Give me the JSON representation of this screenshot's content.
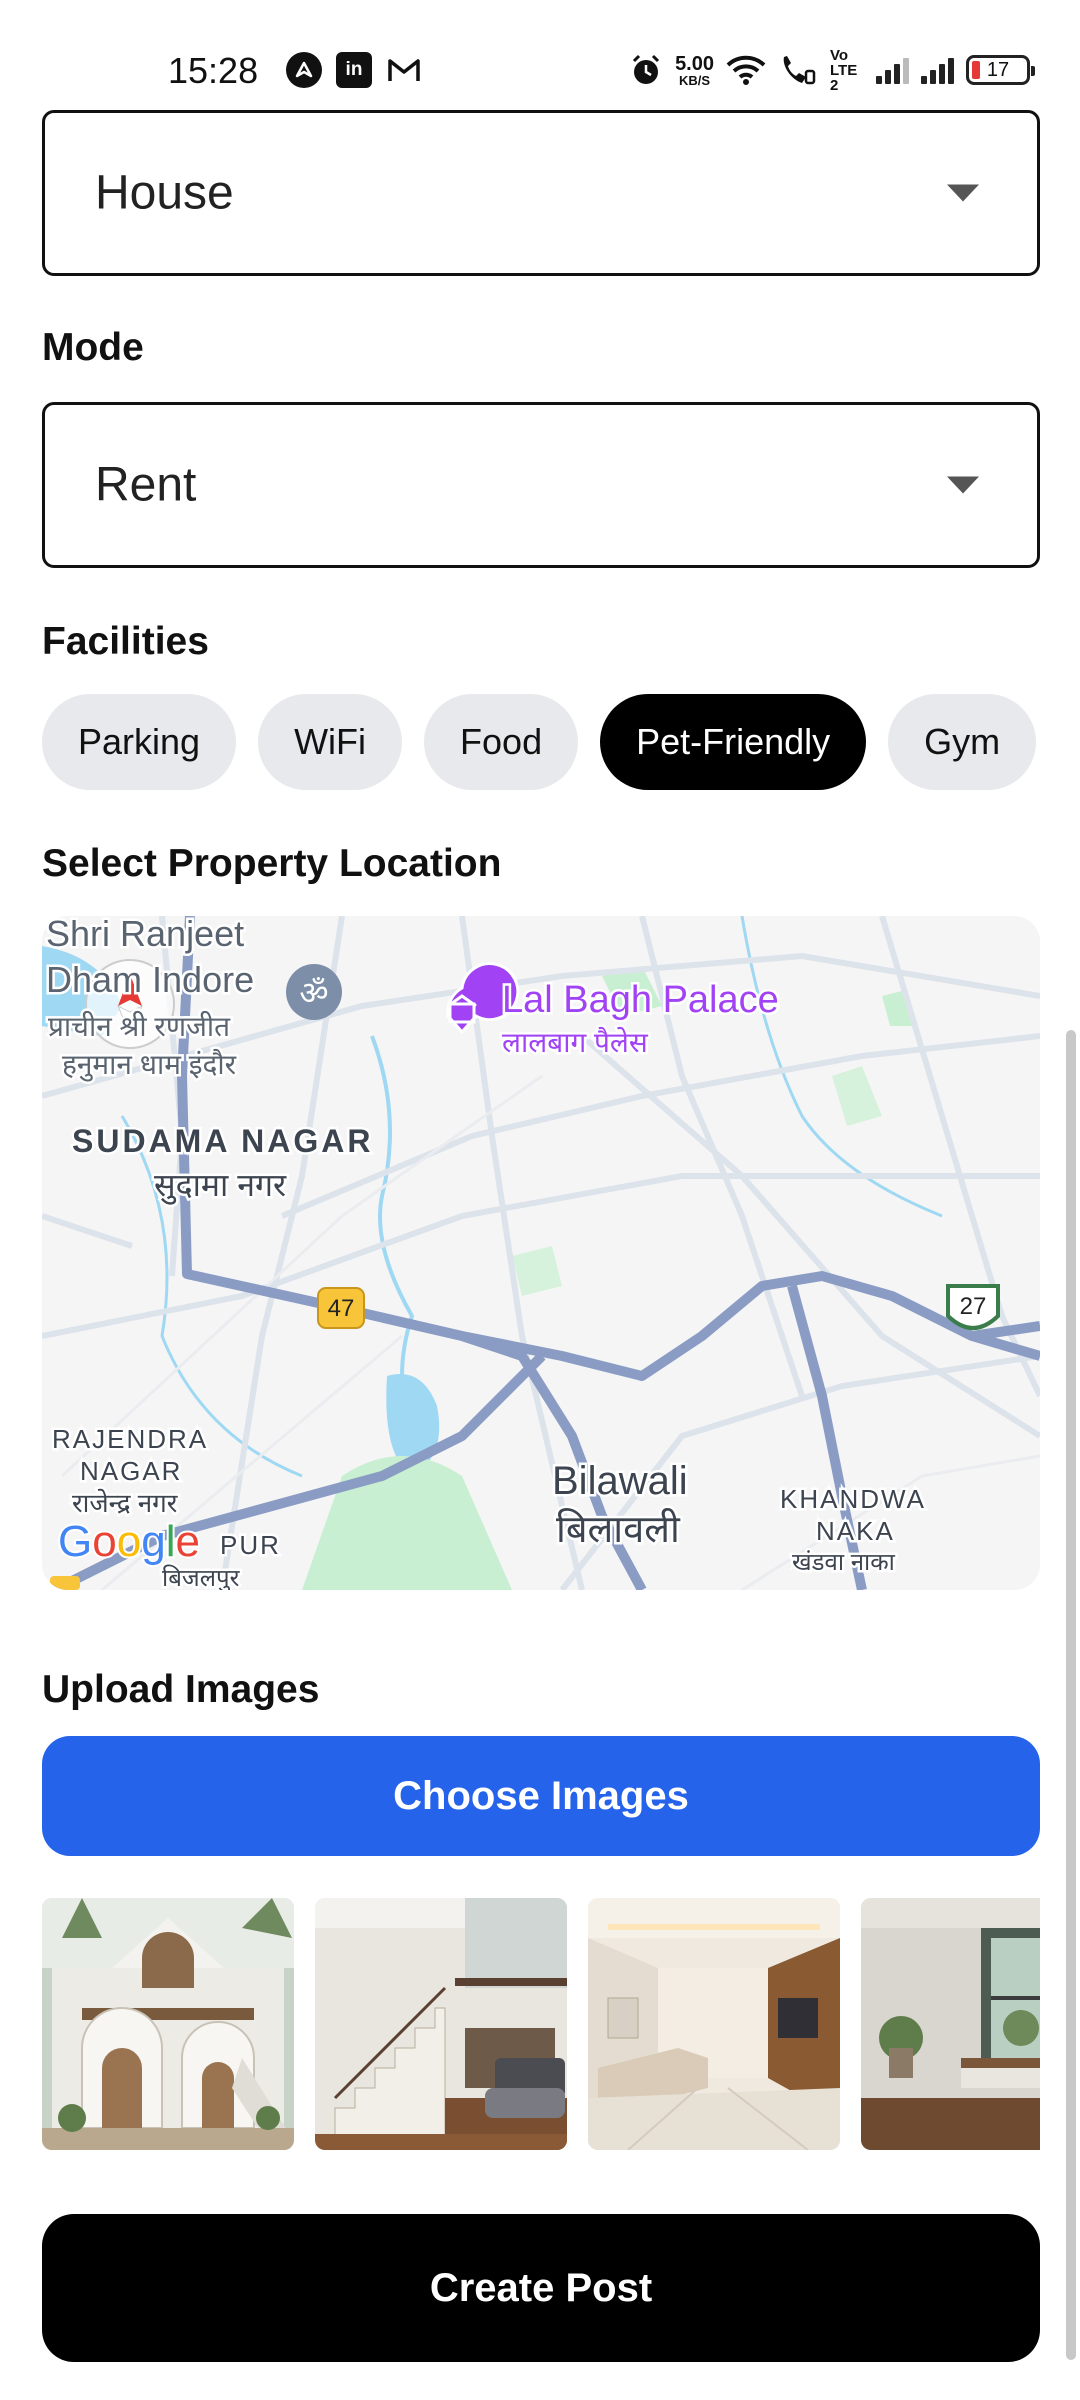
{
  "status_bar": {
    "time": "15:28",
    "apps": [
      "navigation-app-icon",
      "linkedin-icon",
      "gmail-icon"
    ],
    "net_speed": "5.00",
    "net_unit": "KB/S",
    "volte": "Vo LTE2",
    "battery": "17",
    "battery_color": "#e53935"
  },
  "form": {
    "property_type": {
      "value": "House"
    },
    "mode": {
      "label": "Mode",
      "value": "Rent"
    },
    "facilities": {
      "label": "Facilities",
      "chips": [
        {
          "label": "Parking",
          "selected": false
        },
        {
          "label": "WiFi",
          "selected": false
        },
        {
          "label": "Food",
          "selected": false
        },
        {
          "label": "Pet-Friendly",
          "selected": true
        },
        {
          "label": "Gym",
          "selected": false
        }
      ]
    },
    "location": {
      "label": "Select Property Location",
      "map": {
        "places": {
          "shri_en": "Shri Ranjeet",
          "dham_en": "Dham Indore",
          "shri_hi_1": "प्राचीन श्री रणजीत",
          "shri_hi_2": "हनुमान धाम इंदौर",
          "lal_bagh_en": "Lal Bagh Palace",
          "lal_bagh_hi": "लालबाग पैलेस",
          "sudama_en": "SUDAMA NAGAR",
          "sudama_hi": "सुदामा नगर",
          "rajendra_en_1": "RAJENDRA",
          "rajendra_en_2": "NAGAR",
          "rajendra_hi": "राजेन्द्र नगर",
          "bilawali_en": "Bilawali",
          "bilawali_hi": "बिलावली",
          "khandwa_en_1": "KHANDWA",
          "khandwa_en_2": "NAKA",
          "khandwa_hi": "खंडवा नाका",
          "bijalpur_en": "PUR",
          "bijalpur_hi": "बिजलपुर"
        },
        "highways": [
          "47",
          "27"
        ],
        "attribution": "Google",
        "poi_color": "#a142f4",
        "water_color": "#9fd8f3",
        "park_color": "#c9efd2"
      }
    },
    "upload": {
      "label": "Upload Images",
      "button": "Choose Images",
      "button_color": "#2563eb",
      "images": [
        "house-exterior-image",
        "living-room-stairs-image",
        "living-room-sofa-image",
        "window-nook-image"
      ]
    },
    "submit": "Create Post"
  }
}
